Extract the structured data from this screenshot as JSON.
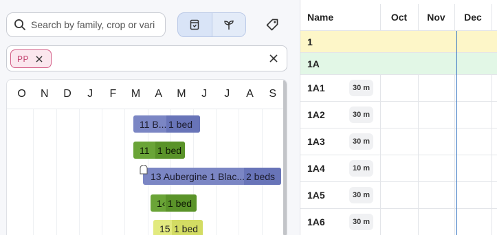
{
  "search": {
    "placeholder": "Search by family, crop or variety",
    "value": ""
  },
  "view_toggle": {
    "options": [
      "bed-view",
      "plant-view"
    ],
    "selected": "bed-view"
  },
  "filter": {
    "chips": [
      {
        "label": "PP"
      }
    ]
  },
  "timeline": {
    "months": [
      "O",
      "N",
      "D",
      "J",
      "F",
      "M",
      "A",
      "M",
      "J",
      "J",
      "A",
      "S"
    ],
    "bars": [
      {
        "label_a": "11 B...",
        "label_b": "1 bed",
        "color": "#7b86c4"
      },
      {
        "label_a": "11",
        "label_b": "1 bed",
        "color": "#6aa437"
      },
      {
        "label_a": "13 Aubergine 1 Blac...",
        "label_b": "2 beds",
        "color": "#7b86c4"
      },
      {
        "label_a": "1‹",
        "label_b": "1 bed",
        "color": "#6aa437"
      },
      {
        "label_a": "15",
        "label_b": "1 bed",
        "color": "#e2ea7f"
      }
    ]
  },
  "beds_table": {
    "headers": {
      "name": "Name",
      "months": [
        "Oct",
        "Nov",
        "Dec"
      ]
    },
    "rows": [
      {
        "name": "1",
        "duration": "",
        "highlight": "#fdf6c8"
      },
      {
        "name": "1A",
        "duration": "",
        "highlight": "#e2f7e6"
      },
      {
        "name": "1A1",
        "duration": "30 m"
      },
      {
        "name": "1A2",
        "duration": "30 m"
      },
      {
        "name": "1A3",
        "duration": "30 m"
      },
      {
        "name": "1A4",
        "duration": "10 m"
      },
      {
        "name": "1A5",
        "duration": "30 m"
      },
      {
        "name": "1A6",
        "duration": "30 m"
      }
    ]
  },
  "colors": {
    "today_line": "#3a78c4",
    "chip_accent": "#d35d86",
    "toggle_selected": "#d9e4f7"
  }
}
